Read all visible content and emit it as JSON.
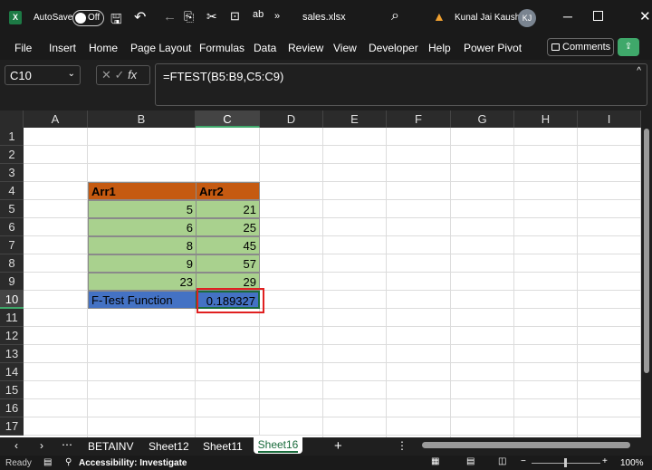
{
  "title": {
    "autosave": "AutoSave",
    "toggle": "Off",
    "file": "sales.xlsx",
    "user": "Kunal Jai Kaushik",
    "initials": "KJ",
    "more": "»"
  },
  "menu": [
    "File",
    "Insert",
    "Home",
    "Page Layout",
    "Formulas",
    "Data",
    "Review",
    "View",
    "Developer",
    "Help",
    "Power Pivot"
  ],
  "comments": "Comments",
  "namebox": "C10",
  "formula": "=FTEST(B5:B9,C5:C9)",
  "fx": "fx",
  "columns": [
    "A",
    "B",
    "C",
    "D",
    "E",
    "F",
    "G",
    "H",
    "I"
  ],
  "rows": [
    "1",
    "2",
    "3",
    "4",
    "5",
    "6",
    "7",
    "8",
    "9",
    "10",
    "11",
    "12",
    "13",
    "14",
    "15",
    "16",
    "17"
  ],
  "table": {
    "h1": "Arr1",
    "h2": "Arr2",
    "arr1": [
      "5",
      "6",
      "8",
      "9",
      "23"
    ],
    "arr2": [
      "21",
      "25",
      "45",
      "57",
      "29"
    ],
    "label": "F-Test Function",
    "result": "0.189327"
  },
  "sheets": [
    "BETAINV",
    "Sheet12",
    "Sheet11",
    "Sheet16"
  ],
  "status": {
    "ready": "Ready",
    "access": "Accessibility: Investigate",
    "zoom": "100%"
  },
  "colors": {
    "header": "#c55a11",
    "data": "#a9d18e",
    "label": "#4472c4",
    "accent": "#3fa86a"
  }
}
